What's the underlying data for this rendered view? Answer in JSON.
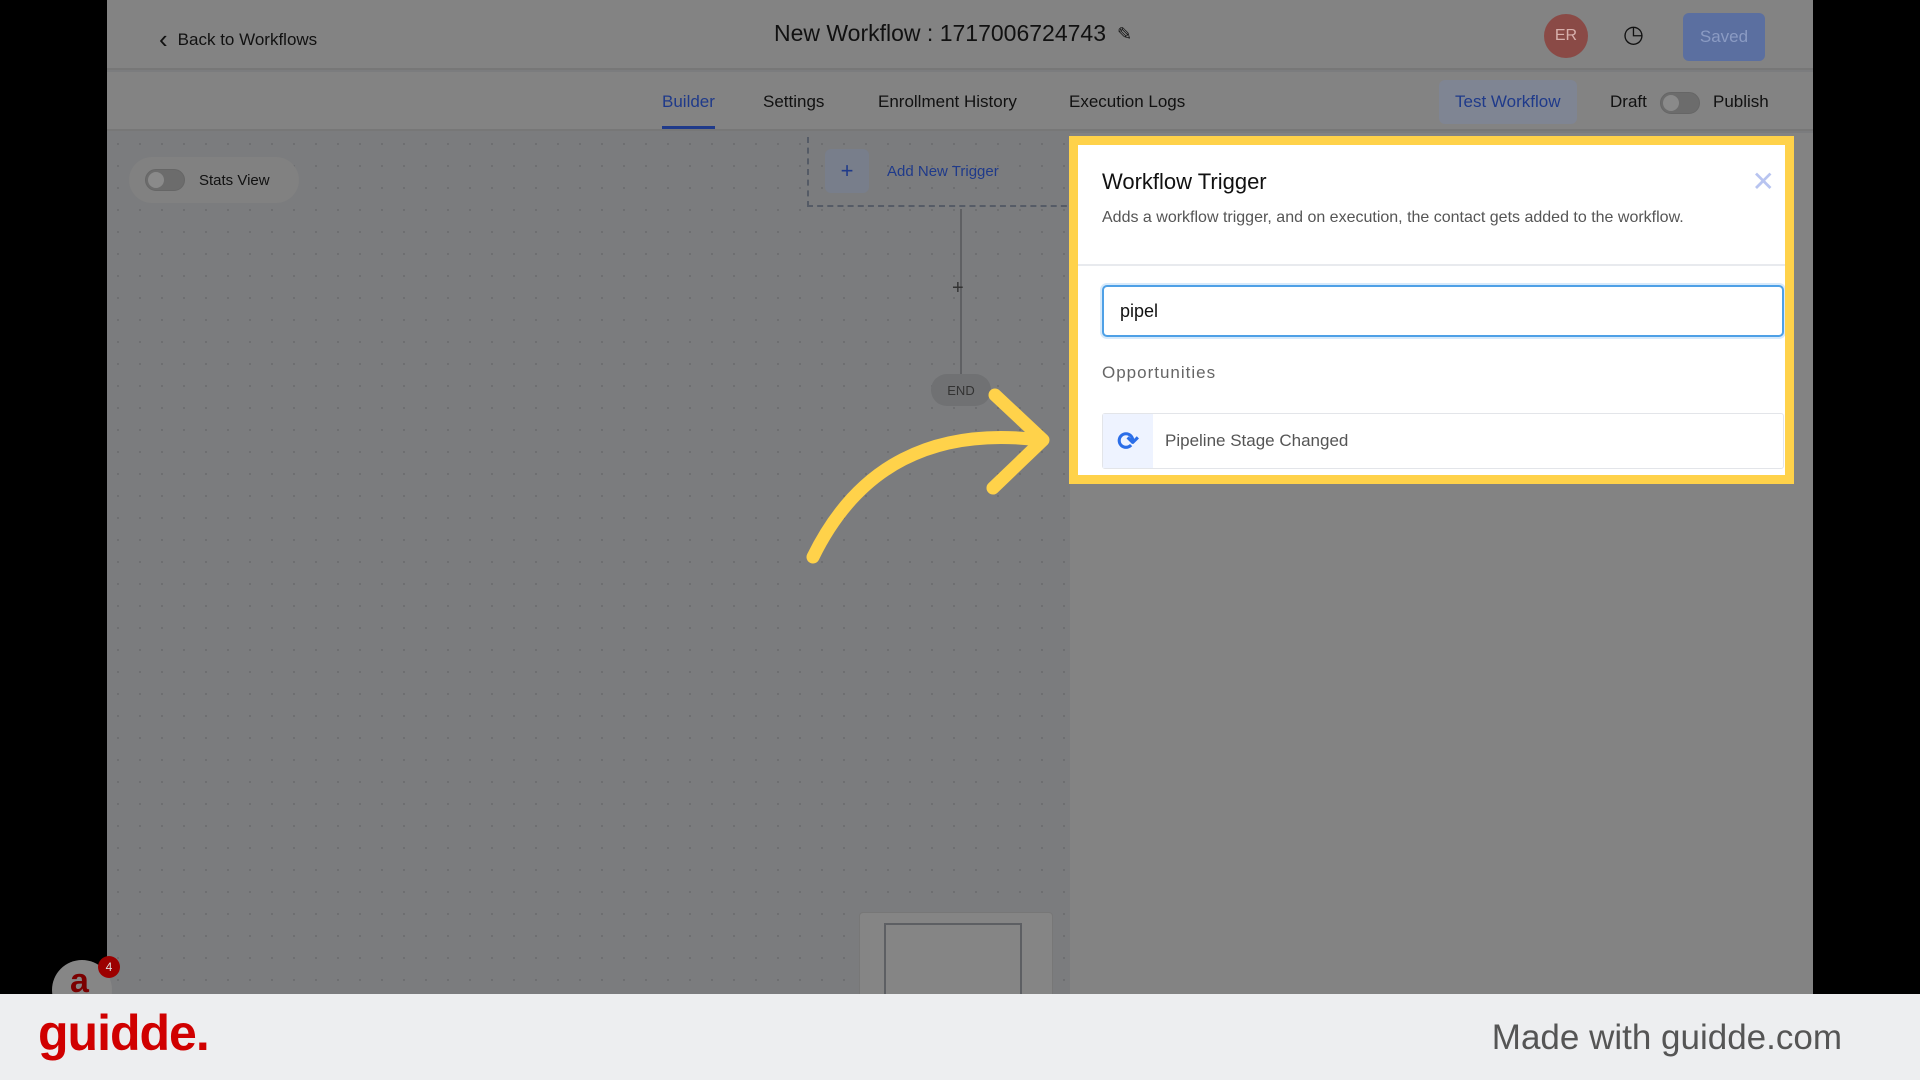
{
  "header": {
    "back_label": "Back to Workflows",
    "title": "New Workflow : 1717006724743",
    "avatar_initials": "ER",
    "saved_label": "Saved"
  },
  "tabs": [
    {
      "label": "Builder",
      "active": true
    },
    {
      "label": "Settings",
      "active": false
    },
    {
      "label": "Enrollment History",
      "active": false
    },
    {
      "label": "Execution Logs",
      "active": false
    }
  ],
  "actions": {
    "test_workflow": "Test Workflow",
    "draft": "Draft",
    "publish": "Publish",
    "published": false
  },
  "canvas": {
    "stats_view": "Stats View",
    "stats_view_on": false,
    "add_trigger": "Add New Trigger",
    "end_label": "END",
    "chat_badge": "4"
  },
  "panel": {
    "title": "Workflow Trigger",
    "description": "Adds a workflow trigger, and on execution, the contact gets added to the workflow.",
    "search_value": "pipel",
    "section": "Opportunities",
    "options": [
      {
        "label": "Pipeline Stage Changed",
        "icon": "refresh-icon"
      }
    ]
  },
  "colors": {
    "highlight": "#ffd24a",
    "accent": "#1f3a8a",
    "brand": "#d00000"
  },
  "footer": {
    "logo": "guidde.",
    "made_with": "Made with guidde.com"
  }
}
